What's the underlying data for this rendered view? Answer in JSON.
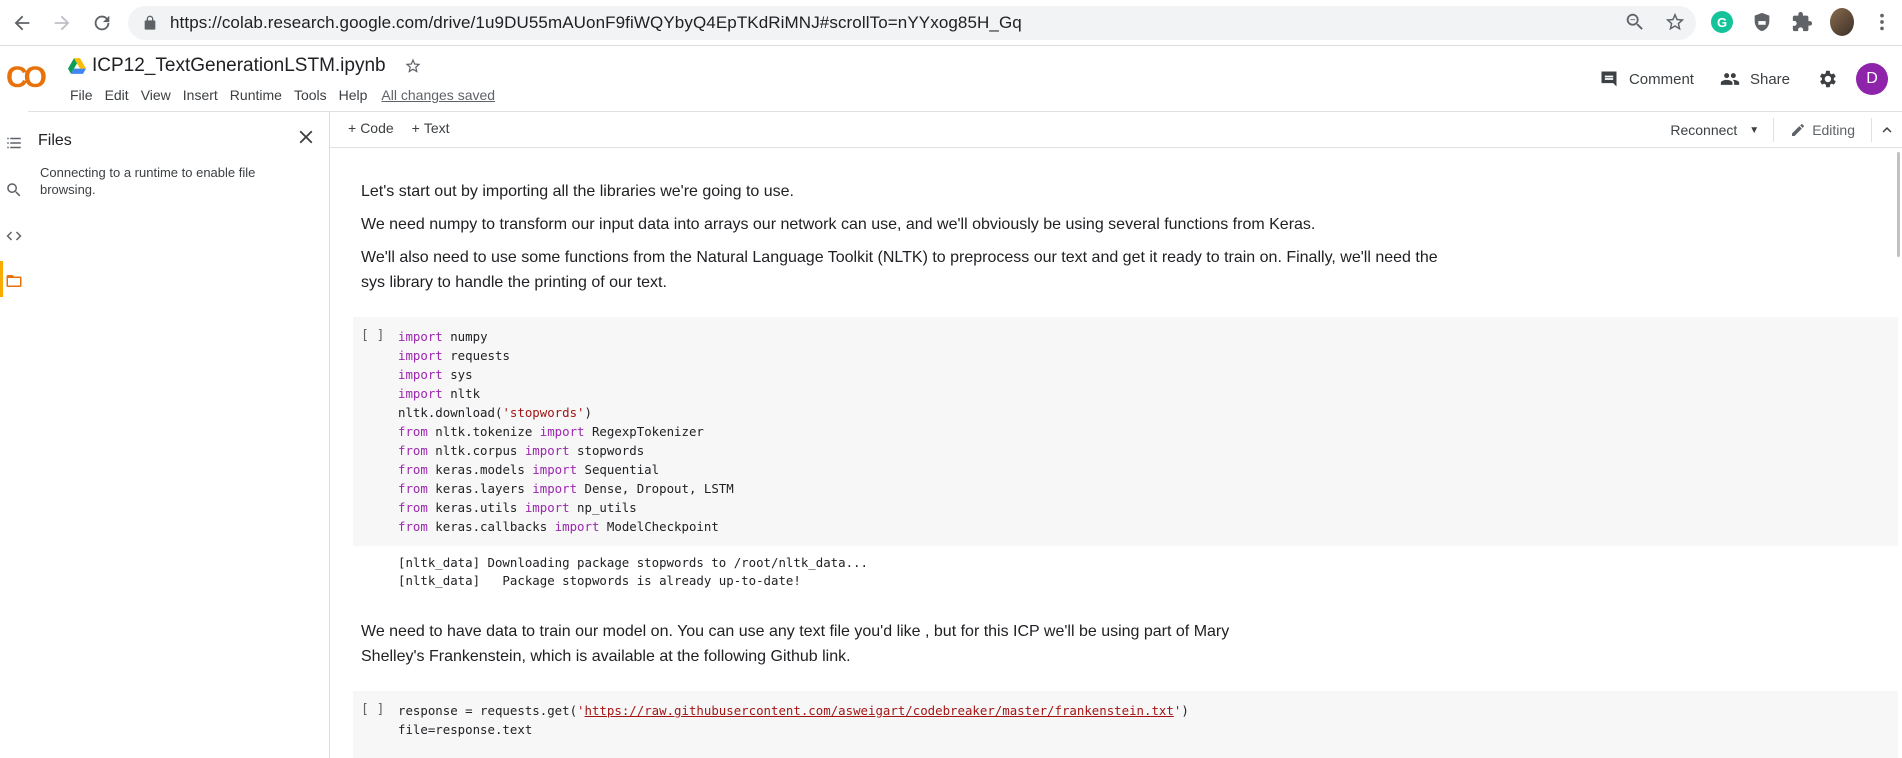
{
  "browser": {
    "url": "https://colab.research.google.com/drive/1u9DU55mAUonF9fiWQYbyQ4EpTKdRiMNJ#scrollTo=nYYxog85H_Gq",
    "grammarly_letter": "G"
  },
  "header": {
    "logo": "CO",
    "title": "ICP12_TextGenerationLSTM.ipynb",
    "menu": [
      "File",
      "Edit",
      "View",
      "Insert",
      "Runtime",
      "Tools",
      "Help"
    ],
    "save_status": "All changes saved",
    "comment_label": "Comment",
    "share_label": "Share",
    "user_initial": "D"
  },
  "toolbar": {
    "add_code": "Code",
    "add_text": "Text",
    "reconnect": "Reconnect",
    "editing": "Editing"
  },
  "files": {
    "title": "Files",
    "message": "Connecting to a runtime to enable file browsing."
  },
  "cells": {
    "text1": {
      "p1": "Let's start out by importing all the libraries we're going to use.",
      "p2": "We need numpy to transform our input data into arrays our network can use, and we'll obviously be using several functions from Keras.",
      "p3": "We'll also need to use some functions from the Natural Language Toolkit (NLTK) to preprocess our text and get it ready to train on. Finally, we'll need the sys library to handle the printing of our text."
    },
    "code1": {
      "run_label": "[ ]",
      "lines": [
        "import numpy",
        "import requests",
        "import sys",
        "import nltk",
        "nltk.download('stopwords')",
        "from nltk.tokenize import RegexpTokenizer",
        "from nltk.corpus import stopwords",
        "from keras.models import Sequential",
        "from keras.layers import Dense, Dropout, LSTM",
        "from keras.utils import np_utils",
        "from keras.callbacks import ModelCheckpoint"
      ],
      "output": [
        "[nltk_data] Downloading package stopwords to /root/nltk_data...",
        "[nltk_data]   Package stopwords is already up-to-date!"
      ]
    },
    "text2": {
      "p1": "We need to have data to train our model on. You can use any text file you'd like , but for this ICP we'll be using part of Mary Shelley's Frankenstein, which is available at the following Github link."
    },
    "code2": {
      "run_label": "[ ]",
      "line1_prefix": "response = requests.get(",
      "line1_url": "https://raw.githubusercontent.com/asweigart/codebreaker/master/frankenstein.txt",
      "line1_suffix": ")",
      "line2": "file=response.text"
    }
  },
  "colors": {
    "keyword": "#9c27b0",
    "string": "#a31515",
    "accent": "#f9ab00",
    "avatar": "#8e24aa"
  }
}
